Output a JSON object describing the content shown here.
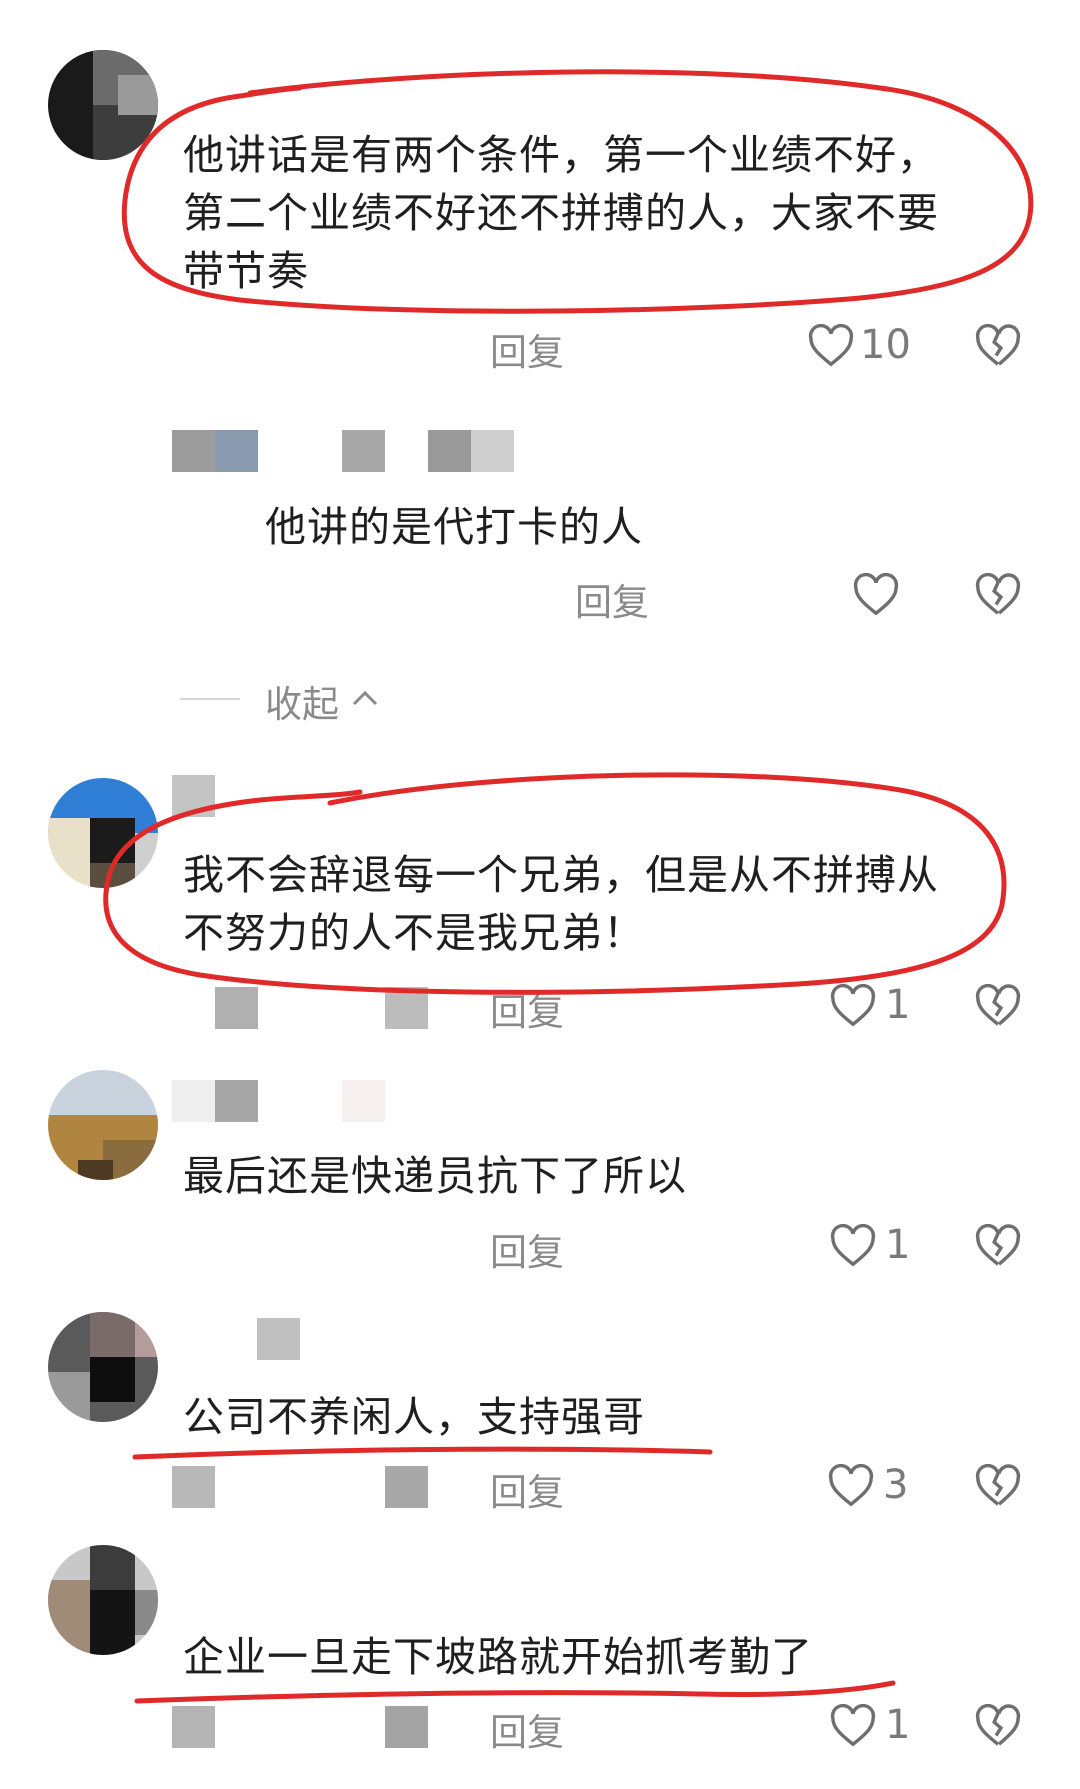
{
  "comments": [
    {
      "text_lines": [
        "他讲话是有两个条件，第一个业绩不好，",
        "第二个业绩不好还不拼搏的人，大家不要",
        "带节奏"
      ],
      "reply_label": "回复",
      "likes": "10"
    },
    {
      "text_lines": [
        "他讲的是代打卡的人"
      ],
      "reply_label": "回复",
      "likes": ""
    },
    {
      "text_lines": [
        "我不会辞退每一个兄弟，但是从不拼搏从",
        "不努力的人不是我兄弟！"
      ],
      "reply_label": "回复",
      "likes": "1"
    },
    {
      "text_lines": [
        "最后还是快递员抗下了所以"
      ],
      "reply_label": "回复",
      "likes": "1"
    },
    {
      "text_lines": [
        "公司不养闲人，支持强哥"
      ],
      "reply_label": "回复",
      "likes": "3"
    },
    {
      "text_lines": [
        "企业一旦走下坡路就开始抓考勤了"
      ],
      "reply_label": "回复",
      "likes": "1"
    }
  ],
  "collapse": {
    "label": "收起"
  },
  "icons": {
    "like": "heart-outline-icon",
    "dislike": "broken-heart-icon",
    "collapse": "chevron-up-icon"
  },
  "colors": {
    "annotation": "#e02a2a",
    "muted": "#8a8a8a"
  }
}
